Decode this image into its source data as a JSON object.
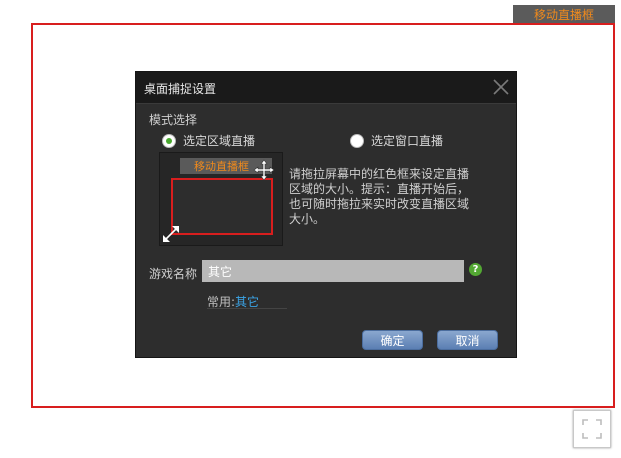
{
  "overlay": {
    "move_tab_label": "移动直播框"
  },
  "dialog": {
    "title": "桌面捕捉设置",
    "mode_section_label": "模式选择",
    "mode_options": [
      {
        "label": "选定区域直播",
        "selected": true
      },
      {
        "label": "选定窗口直播",
        "selected": false
      }
    ],
    "preview": {
      "tab_label": "移动直播框"
    },
    "help_text": "请拖拉屏幕中的红色框来设定直播区域的大小。提示：直播开始后，也可随时拖拉来实时改变直播区域大小。",
    "game_name_label": "游戏名称",
    "game_name_value": "其它",
    "help_icon_glyph": "?",
    "common_label": "常用:",
    "common_link": "其它",
    "confirm_label": "确定",
    "cancel_label": "取消"
  },
  "colors": {
    "capture_border": "#d81e1e",
    "accent_orange": "#f08a1c",
    "link_blue": "#3ba4e6",
    "radio_selected": "#49a82f",
    "button_blue": "#6f8fc2"
  },
  "icons": {
    "close": "close-icon",
    "move": "move-icon",
    "resize": "resize-icon",
    "help": "help-icon",
    "fullscreen": "fullscreen-icon"
  }
}
